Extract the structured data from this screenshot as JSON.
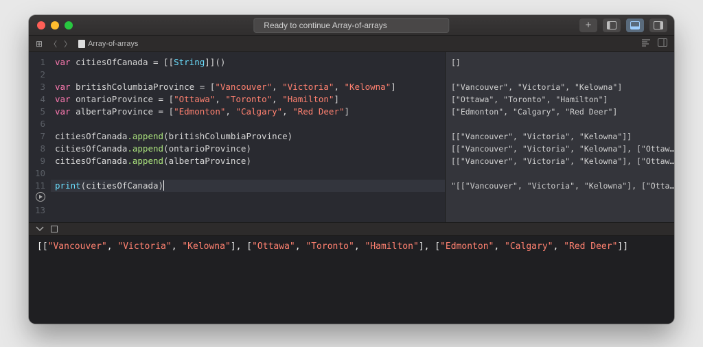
{
  "window": {
    "title": "Ready to continue Array-of-arrays"
  },
  "breadcrumb": {
    "file": "Array-of-arrays"
  },
  "code": {
    "lines": [
      "1",
      "2",
      "3",
      "4",
      "5",
      "6",
      "7",
      "8",
      "9",
      "10",
      "11",
      "",
      "13"
    ],
    "l1_kw": "var ",
    "l1_id": "citiesOfCanada",
    "l1_rest": " = [[",
    "l1_type": "String",
    "l1_tail": "]]()",
    "l3_kw": "var ",
    "l3_id": "britishColumbiaProvince",
    "l3_eq": " = [",
    "l3_s1": "\"Vancouver\"",
    "l3_s2": "\"Victoria\"",
    "l3_s3": "\"Kelowna\"",
    "l4_kw": "var ",
    "l4_id": "ontarioProvince",
    "l4_eq": " = [",
    "l4_s1": "\"Ottawa\"",
    "l4_s2": "\"Toronto\"",
    "l4_s3": "\"Hamilton\"",
    "l5_kw": "var ",
    "l5_id": "albertaProvince",
    "l5_eq": " = [",
    "l5_s1": "\"Edmonton\"",
    "l5_s2": "\"Calgary\"",
    "l5_s3": "\"Red Deer\"",
    "l7_id": "citiesOfCanada",
    "l7_mt": ".append",
    "l7_arg": "britishColumbiaProvince",
    "l8_id": "citiesOfCanada",
    "l8_mt": ".append",
    "l8_arg": "ontarioProvince",
    "l9_id": "citiesOfCanada",
    "l9_mt": ".append",
    "l9_arg": "albertaProvince",
    "l11_fn": "print",
    "l11_arg": "citiesOfCanada",
    "comma": ", ",
    "close": "]",
    "paren_o": "(",
    "paren_c": ")"
  },
  "results": {
    "r1": "[]",
    "r3": "[\"Vancouver\", \"Victoria\", \"Kelowna\"]",
    "r4": "[\"Ottawa\", \"Toronto\", \"Hamilton\"]",
    "r5": "[\"Edmonton\", \"Calgary\", \"Red Deer\"]",
    "r7": "[[\"Vancouver\", \"Victoria\", \"Kelowna\"]]",
    "r8": "[[\"Vancouver\", \"Victoria\", \"Kelowna\"], [\"Ottaw…",
    "r9": "[[\"Vancouver\", \"Victoria\", \"Kelowna\"], [\"Ottaw…",
    "r11": "\"[[\"Vancouver\", \"Victoria\", \"Kelowna\"], [\"Otta…"
  },
  "console": {
    "out_pre": "[[",
    "out_s1": "\"Vancouver\"",
    "out_s2": "\"Victoria\"",
    "out_s3": "\"Kelowna\"",
    "out_mid1": "], [",
    "out_s4": "\"Ottawa\"",
    "out_s5": "\"Toronto\"",
    "out_s6": "\"Hamilton\"",
    "out_mid2": "], [",
    "out_s7": "\"Edmonton\"",
    "out_s8": "\"Calgary\"",
    "out_s9": "\"Red Deer\"",
    "out_suf": "]]",
    "comma": ", "
  }
}
